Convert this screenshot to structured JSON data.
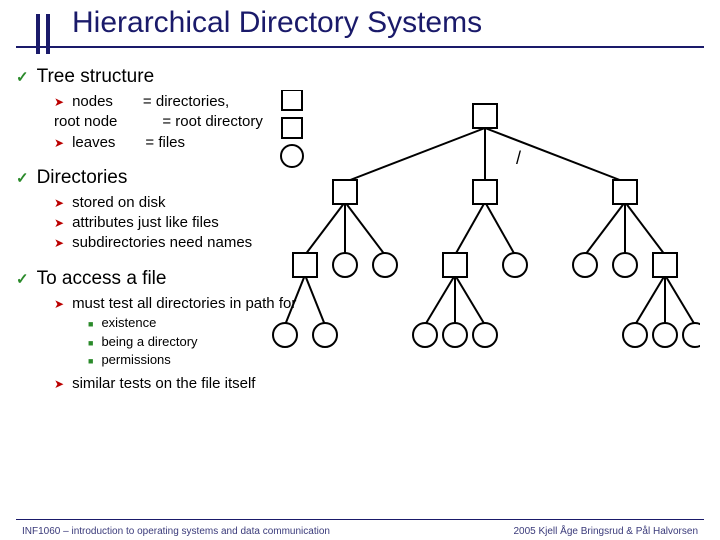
{
  "title": "Hierarchical Directory Systems",
  "sections": [
    {
      "heading": "Tree structure",
      "items": [
        {
          "text": "nodes  = directories,\n root node   = root directory"
        },
        {
          "text": "leaves  = files"
        }
      ]
    },
    {
      "heading": "Directories",
      "items": [
        {
          "text": "stored on disk"
        },
        {
          "text": "attributes just like files"
        },
        {
          "text": "subdirectories need names"
        }
      ]
    },
    {
      "heading": "To access a file",
      "items": [
        {
          "text": "must test all directories in path for",
          "sub": [
            "existence",
            "being a directory",
            "permissions"
          ]
        },
        {
          "text": "similar tests on the file itself"
        }
      ]
    }
  ],
  "diagram": {
    "root_label": "/",
    "legend_square": "directory",
    "legend_circle": "file"
  },
  "footer": {
    "left": "INF1060 – introduction to operating systems and data communication",
    "right": "2005 Kjell Åge Bringsrud & Pål Halvorsen"
  }
}
